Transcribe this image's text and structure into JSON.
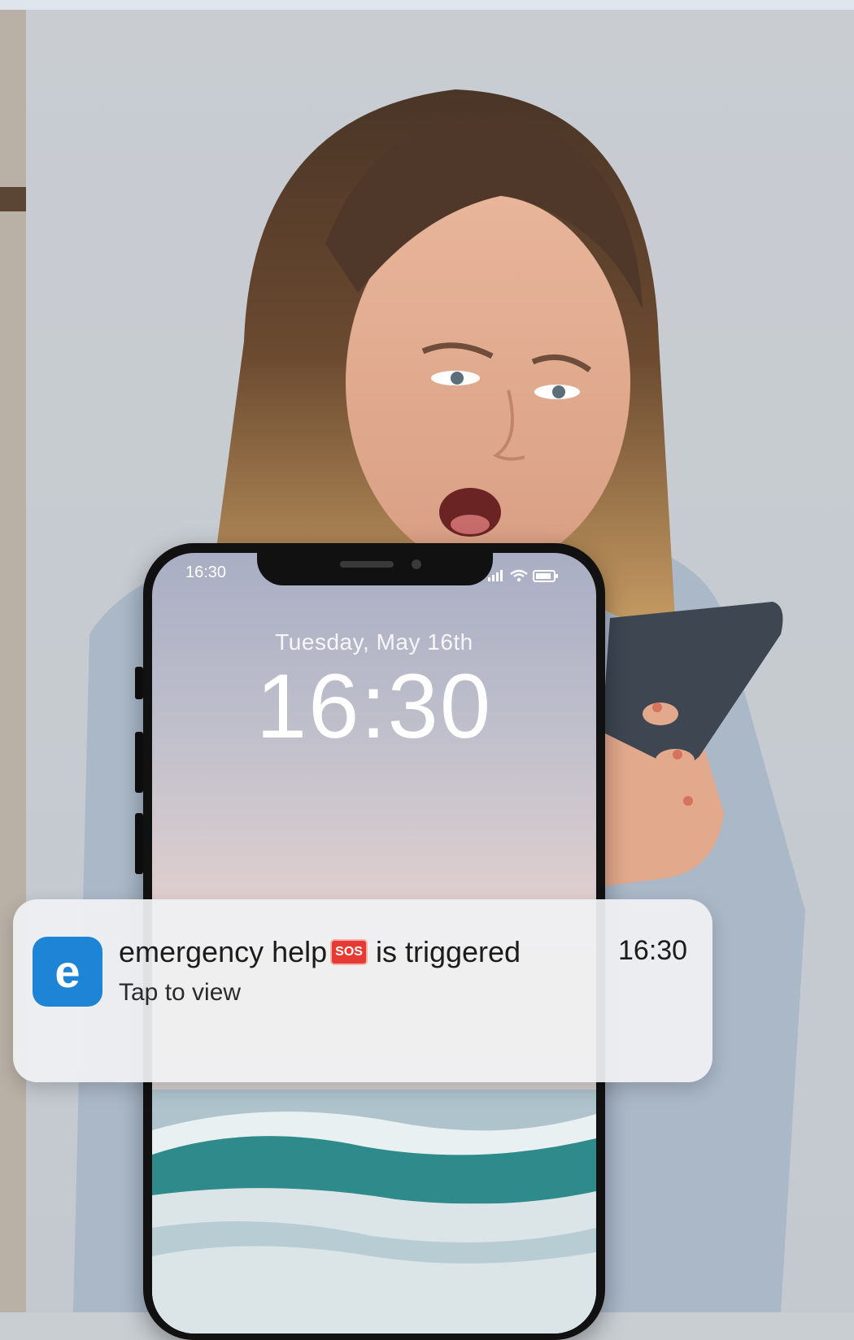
{
  "status_bar": {
    "time": "16:30"
  },
  "lock_screen": {
    "date": "Tuesday, May 16th",
    "time": "16:30"
  },
  "notification": {
    "app_icon_letter": "e",
    "title_before": "emergency help",
    "badge": "SOS",
    "title_after": "is triggered",
    "subtitle": "Tap to view",
    "time": "16:30"
  },
  "colors": {
    "app_icon": "#1d84d6",
    "sos_badge": "#e63a32"
  }
}
